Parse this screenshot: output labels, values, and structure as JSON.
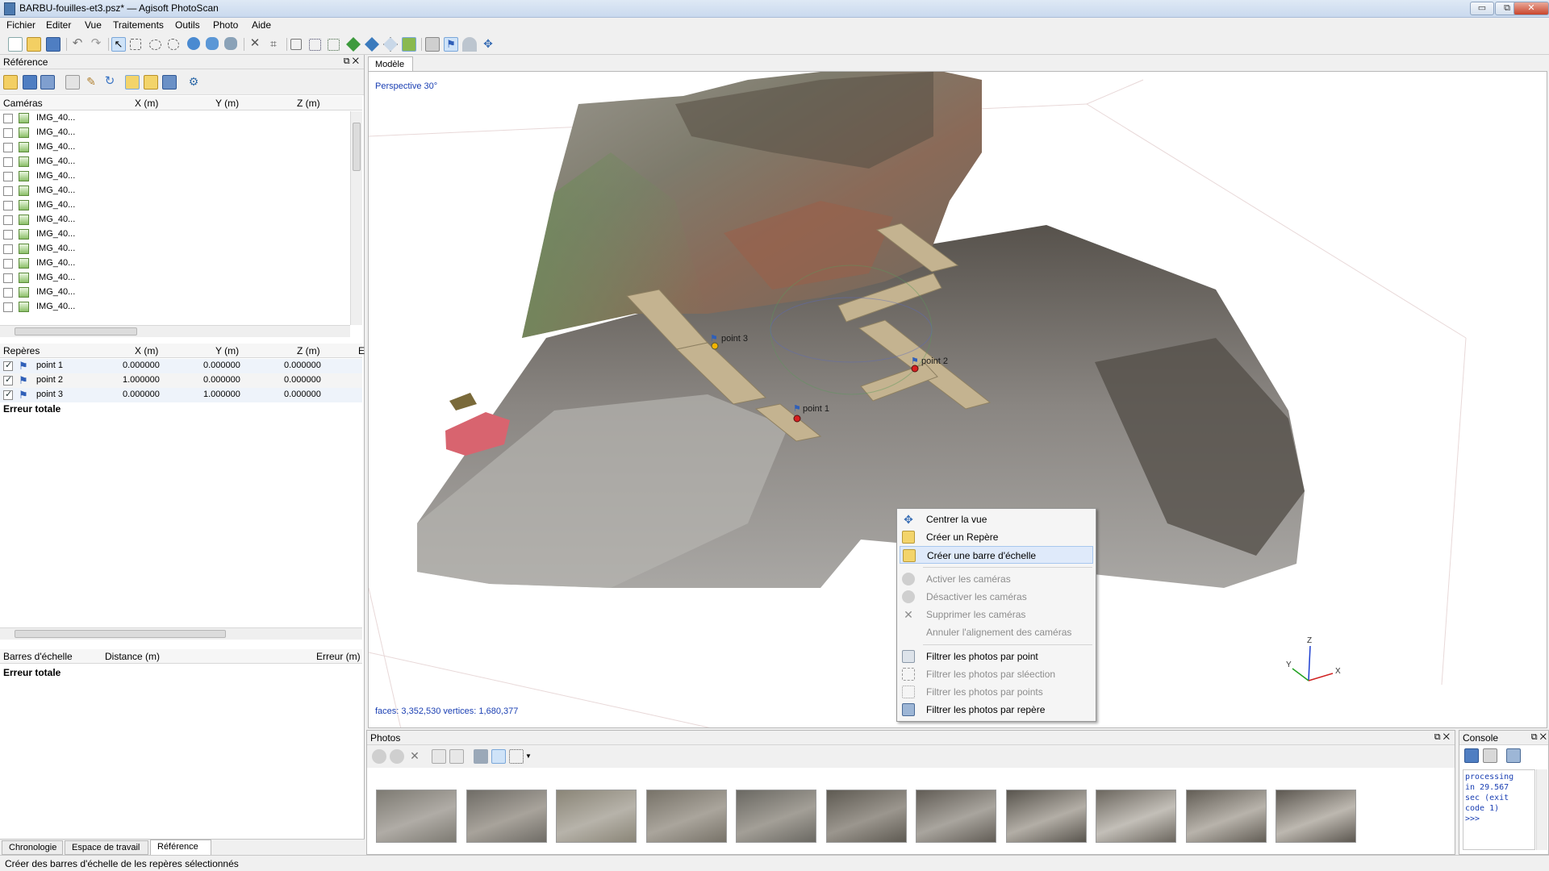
{
  "window": {
    "title": "BARBU-fouilles-et3.psz* — Agisoft PhotoScan",
    "min": "▭",
    "max": "⧉",
    "close": "✕"
  },
  "menu": [
    "Fichier",
    "Editer",
    "Vue",
    "Traitements",
    "Outils",
    "Photo",
    "Aide"
  ],
  "reference_panel": {
    "title": "Référence",
    "cameras": {
      "headers": {
        "name": "Caméras",
        "x": "X (m)",
        "y": "Y (m)",
        "z": "Z (m)"
      },
      "rows": [
        "IMG_40...",
        "IMG_40...",
        "IMG_40...",
        "IMG_40...",
        "IMG_40...",
        "IMG_40...",
        "IMG_40...",
        "IMG_40...",
        "IMG_40...",
        "IMG_40...",
        "IMG_40...",
        "IMG_40...",
        "IMG_40...",
        "IMG_40..."
      ]
    },
    "markers": {
      "headers": {
        "name": "Repères",
        "x": "X (m)",
        "y": "Y (m)",
        "z": "Z (m)",
        "extra": "E"
      },
      "rows": [
        {
          "name": "point 1",
          "x": "0.000000",
          "y": "0.000000",
          "z": "0.000000"
        },
        {
          "name": "point 2",
          "x": "1.000000",
          "y": "0.000000",
          "z": "0.000000"
        },
        {
          "name": "point 3",
          "x": "0.000000",
          "y": "1.000000",
          "z": "0.000000"
        }
      ],
      "total": "Erreur totale"
    },
    "scalebars": {
      "headers": {
        "name": "Barres d'échelle",
        "distance": "Distance (m)",
        "error": "Erreur (m)"
      },
      "total": "Erreur totale"
    }
  },
  "bottom_tabs": [
    "Chronologie",
    "Espace de travail",
    "Référence"
  ],
  "model": {
    "tab": "Modèle",
    "perspective": "Perspective 30°",
    "stats": "faces: 3,352,530 vertices: 1,680,377",
    "markers": [
      "point 1",
      "point 2",
      "point 3"
    ],
    "axes": {
      "x": "X",
      "y": "Y",
      "z": "Z"
    }
  },
  "context_menu": [
    {
      "label": "Centrer la vue",
      "enabled": true
    },
    {
      "label": "Créer un Repère",
      "enabled": true
    },
    {
      "label": "Créer une barre d'échelle",
      "enabled": true,
      "highlighted": true
    },
    {
      "label": "Activer les caméras",
      "enabled": false
    },
    {
      "label": "Désactiver les caméras",
      "enabled": false
    },
    {
      "label": "Supprimer les caméras",
      "enabled": false
    },
    {
      "label": "Annuler l'alignement des caméras",
      "enabled": false
    },
    {
      "label": "Filtrer les photos par point",
      "enabled": true
    },
    {
      "label": "Filtrer les photos par sléection",
      "enabled": false
    },
    {
      "label": "Filtrer les photos par points",
      "enabled": false
    },
    {
      "label": "Filtrer les photos par repère",
      "enabled": true
    }
  ],
  "photos_panel": {
    "title": "Photos",
    "thumb_count": 11
  },
  "console": {
    "title": "Console",
    "lines": [
      "processing",
      "in 29.567",
      "sec (exit",
      "code 1)",
      ">>>"
    ]
  },
  "status": "Créer des barres d'échelle de les repères sélectionnés",
  "colors": {
    "accent": "#1a3fb3",
    "highlight": "#dfeafa",
    "marker_red": "#d62020",
    "marker_yellow": "#f2b400"
  }
}
